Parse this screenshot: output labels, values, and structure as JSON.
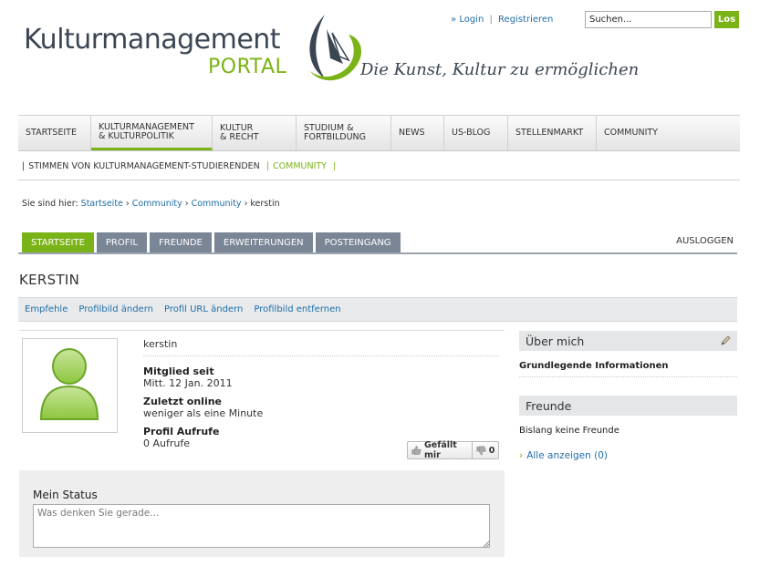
{
  "header": {
    "logo_main": "Kulturmanagement",
    "logo_sub": "PORTAL",
    "tagline": "Die Kunst, Kultur zu ermöglichen",
    "login_prefix": "»",
    "login_label": "Login",
    "register_label": "Registrieren",
    "search_placeholder": "Suchen...",
    "search_button": "Los"
  },
  "mainnav": [
    {
      "line1": "Startseite",
      "line2": ""
    },
    {
      "line1": "Kulturmanagement",
      "line2": "& Kulturpolitik"
    },
    {
      "line1": "Kultur",
      "line2": "& Recht"
    },
    {
      "line1": "Studium &",
      "line2": "Fortbildung"
    },
    {
      "line1": "News",
      "line2": ""
    },
    {
      "line1": "US-Blog",
      "line2": ""
    },
    {
      "line1": "Stellenmarkt",
      "line2": ""
    },
    {
      "line1": "Community",
      "line2": ""
    }
  ],
  "subnav": {
    "item1": "Stimmen von Kulturmanagement-Studierenden",
    "item2": "Community"
  },
  "breadcrumb": {
    "prefix": "Sie sind hier:",
    "crumb1": "Startseite",
    "crumb2": "Community",
    "crumb3": "Community",
    "current": "kerstin"
  },
  "tabs": [
    "Startseite",
    "Profil",
    "Freunde",
    "Erweiterungen",
    "Posteingang"
  ],
  "logout": "Ausloggen",
  "profile": {
    "title": "kerstin",
    "username": "kerstin",
    "member_label": "Mitglied seit",
    "member_value": "Mitt. 12 Jan. 2011",
    "online_label": "Zuletzt online",
    "online_value": "weniger als eine Minute",
    "views_label": "Profil Aufrufe",
    "views_value": "0 Aufrufe",
    "like_label": "Gefällt mir",
    "dislike_count": "0"
  },
  "actions": [
    "Empfehle",
    "Profilbild ändern",
    "Profil URL ändern",
    "Profilbild entfernen"
  ],
  "status": {
    "title": "Mein Status",
    "placeholder": "Was denken Sie gerade..."
  },
  "sidebar": {
    "about_title": "Über mich",
    "about_sub": "Grundlegende Informationen",
    "friends_title": "Freunde",
    "friends_text": "Bislang keine Freunde",
    "show_all": "Alle anzeigen (0)"
  },
  "colors": {
    "accent_green": "#7ab317",
    "link_blue": "#1f6ea7",
    "tab_gray": "#7a8695"
  }
}
